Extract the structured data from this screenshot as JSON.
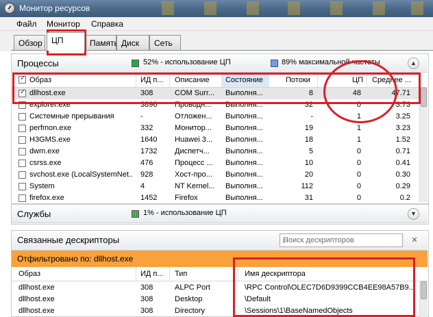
{
  "window": {
    "title": "Монитор ресурсов"
  },
  "menu": [
    "Файл",
    "Монитор",
    "Справка"
  ],
  "tabs": [
    "Обзор",
    "ЦП",
    "Память",
    "Диск",
    "Сеть"
  ],
  "processes": {
    "label": "Процессы",
    "cpu_usage": "52% - использование ЦП",
    "max_freq": "89% максимальной частоты",
    "columns": [
      "Образ",
      "ИД п...",
      "Описание",
      "Состояние",
      "Потоки",
      "ЦП",
      "Среднее ..."
    ],
    "rows": [
      {
        "image": "dllhost.exe",
        "pid": "308",
        "desc": "COM Surr...",
        "state": "Выполня...",
        "threads": "8",
        "cpu": "48",
        "avg": "47.71",
        "checked": true,
        "selected": true
      },
      {
        "image": "explorer.exe",
        "pid": "3896",
        "desc": "Проводн...",
        "state": "Выполня...",
        "threads": "32",
        "cpu": "0",
        "avg": "3.73",
        "checked": false
      },
      {
        "image": "Системные прерывания",
        "pid": "-",
        "desc": "Отложен...",
        "state": "Выполня...",
        "threads": "-",
        "cpu": "1",
        "avg": "3.25",
        "checked": false
      },
      {
        "image": "perfmon.exe",
        "pid": "332",
        "desc": "Монитор...",
        "state": "Выполня...",
        "threads": "19",
        "cpu": "1",
        "avg": "3.23",
        "checked": false
      },
      {
        "image": "H3GMS.exe",
        "pid": "1640",
        "desc": "Huawei 3...",
        "state": "Выполня...",
        "threads": "18",
        "cpu": "1",
        "avg": "1.52",
        "checked": false
      },
      {
        "image": "dwm.exe",
        "pid": "1732",
        "desc": "Диспетч...",
        "state": "Выполня...",
        "threads": "5",
        "cpu": "0",
        "avg": "0.71",
        "checked": false
      },
      {
        "image": "csrss.exe",
        "pid": "476",
        "desc": "Процесс ...",
        "state": "Выполня...",
        "threads": "10",
        "cpu": "0",
        "avg": "0.41",
        "checked": false
      },
      {
        "image": "svchost.exe (LocalSystemNet...",
        "pid": "928",
        "desc": "Хост-про...",
        "state": "Выполня...",
        "threads": "20",
        "cpu": "0",
        "avg": "0.30",
        "checked": false
      },
      {
        "image": "System",
        "pid": "4",
        "desc": "NT Kernel...",
        "state": "Выполня...",
        "threads": "112",
        "cpu": "0",
        "avg": "0.29",
        "checked": false
      },
      {
        "image": "firefox.exe",
        "pid": "1452",
        "desc": "Firefox",
        "state": "Выполня...",
        "threads": "31",
        "cpu": "0",
        "avg": "0.2",
        "checked": false
      }
    ]
  },
  "services": {
    "label": "Службы",
    "cpu_usage": "1% - использование ЦП"
  },
  "handles": {
    "label": "Связанные дескрипторы",
    "search_placeholder": "Поиск дескрипторов",
    "filter_text": "Отфильтровано по: dllhost.exe",
    "columns": [
      "Образ",
      "ИД п...",
      "Тип",
      "Имя дескриптора"
    ],
    "rows": [
      {
        "image": "dllhost.exe",
        "pid": "308",
        "type": "ALPC Port",
        "name": "\\RPC Control\\OLEC7D6D9399CCB4EE98A57B9..."
      },
      {
        "image": "dllhost.exe",
        "pid": "308",
        "type": "Desktop",
        "name": "\\Default"
      },
      {
        "image": "dllhost.exe",
        "pid": "308",
        "type": "Directory",
        "name": "\\Sessions\\1\\BaseNamedObjects"
      }
    ]
  },
  "colors": {
    "highlight": "#d91f26",
    "filter_bar": "#f9a13c",
    "selected_row": "#e6e6e6"
  }
}
